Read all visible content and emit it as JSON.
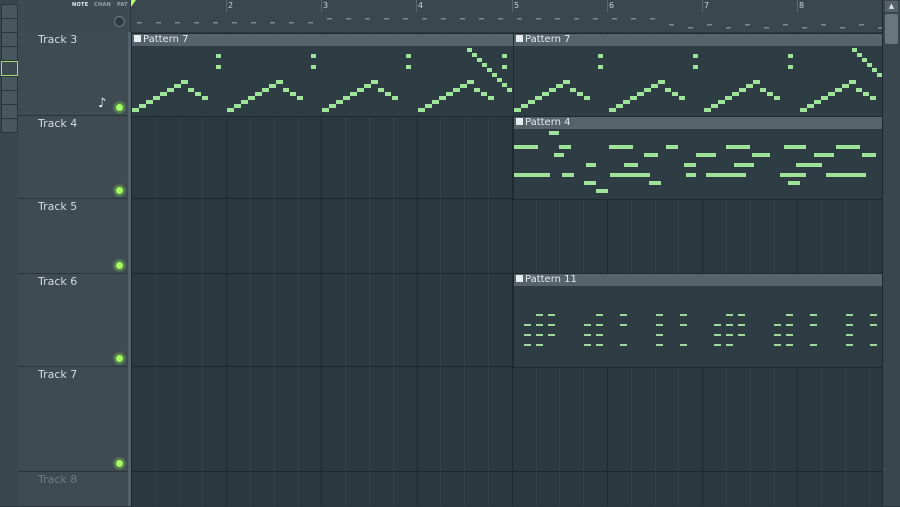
{
  "toolbar": {
    "modes": [
      "NOTE",
      "CHAN",
      "PAT"
    ],
    "selected_mode": "NOTE",
    "snap_icon": "circle-icon"
  },
  "ruler": {
    "bars": [
      "2",
      "3",
      "4",
      "5",
      "6",
      "7",
      "8"
    ],
    "playhead_icon": "playhead-marker-icon"
  },
  "tracks": [
    {
      "name": "Track 3",
      "icon": "note-icon",
      "led": "#a8ff6c"
    },
    {
      "name": "Track 4",
      "led": "#a8ff6c"
    },
    {
      "name": "Track 5",
      "led": "#a8ff6c"
    },
    {
      "name": "Track 6",
      "led": "#a8ff6c"
    },
    {
      "name": "Track 7",
      "led": "#a8ff6c"
    },
    {
      "name": "Track 8",
      "led": "#a8ff6c"
    }
  ],
  "patterns": [
    {
      "label": "Pattern 7",
      "track": "Track 3"
    },
    {
      "label": "Pattern 7",
      "track": "Track 3"
    },
    {
      "label": "Pattern 4",
      "track": "Track 4"
    },
    {
      "label": "Pattern 11",
      "track": "Track 6"
    }
  ],
  "colors": {
    "note": "#9fe39a",
    "led": "#a8ff6c",
    "background": "#2b3840",
    "pattern_header": "#56636b"
  },
  "scrollbar": {
    "up_icon": "scroll-up-icon"
  }
}
